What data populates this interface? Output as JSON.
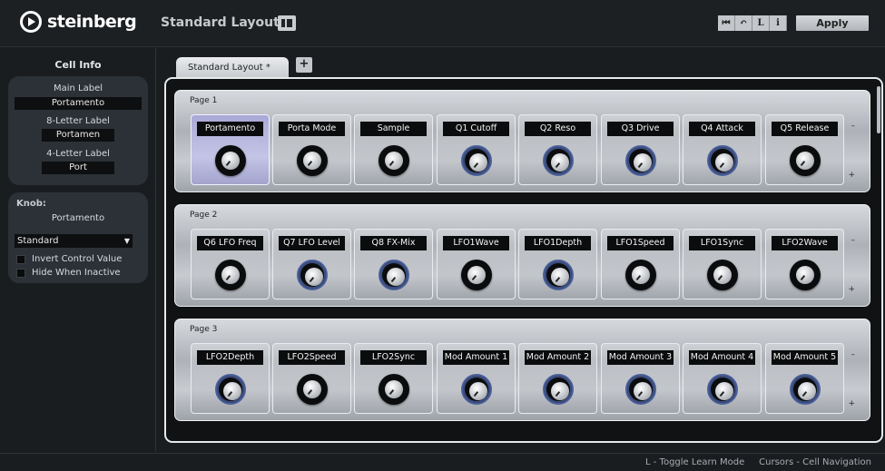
{
  "brand": {
    "name": "steinberg"
  },
  "header": {
    "layout_name": "Standard Layout",
    "toolbar_buttons": [
      "⏮",
      "↶",
      "L",
      "i"
    ],
    "apply_label": "Apply"
  },
  "cell_info": {
    "title": "Cell Info",
    "main_label_caption": "Main Label",
    "main_label_value": "Portamento",
    "eight_letter_caption": "8-Letter Label",
    "eight_letter_value": "Portamen",
    "four_letter_caption": "4-Letter Label",
    "four_letter_value": "Port"
  },
  "knob_panel": {
    "title": "Knob:",
    "name": "Portamento",
    "style_value": "Standard",
    "invert_label": "Invert Control Value",
    "hide_label": "Hide When Inactive"
  },
  "tab": {
    "label": "Standard Layout *",
    "add_label": "+"
  },
  "pages": [
    {
      "name": "Page 1",
      "cells": [
        "Portamento",
        "Porta Mode",
        "Sample",
        "Q1 Cutoff",
        "Q2 Reso",
        "Q3 Drive",
        "Q4 Attack",
        "Q5 Release"
      ]
    },
    {
      "name": "Page 2",
      "cells": [
        "Q6 LFO Freq",
        "Q7 LFO Level",
        "Q8 FX-Mix",
        "LFO1Wave",
        "LFO1Depth",
        "LFO1Speed",
        "LFO1Sync",
        "LFO2Wave"
      ]
    },
    {
      "name": "Page 3",
      "cells": [
        "LFO2Depth",
        "LFO2Speed",
        "LFO2Sync",
        "Mod Amount 1",
        "Mod Amount 2",
        "Mod Amount 3",
        "Mod Amount 4",
        "Mod Amount 5"
      ]
    }
  ],
  "page_controls": {
    "minus": "–",
    "plus": "+"
  },
  "status": {
    "text": "L - Toggle Learn Mode     Cursors - Cell Navigation"
  }
}
